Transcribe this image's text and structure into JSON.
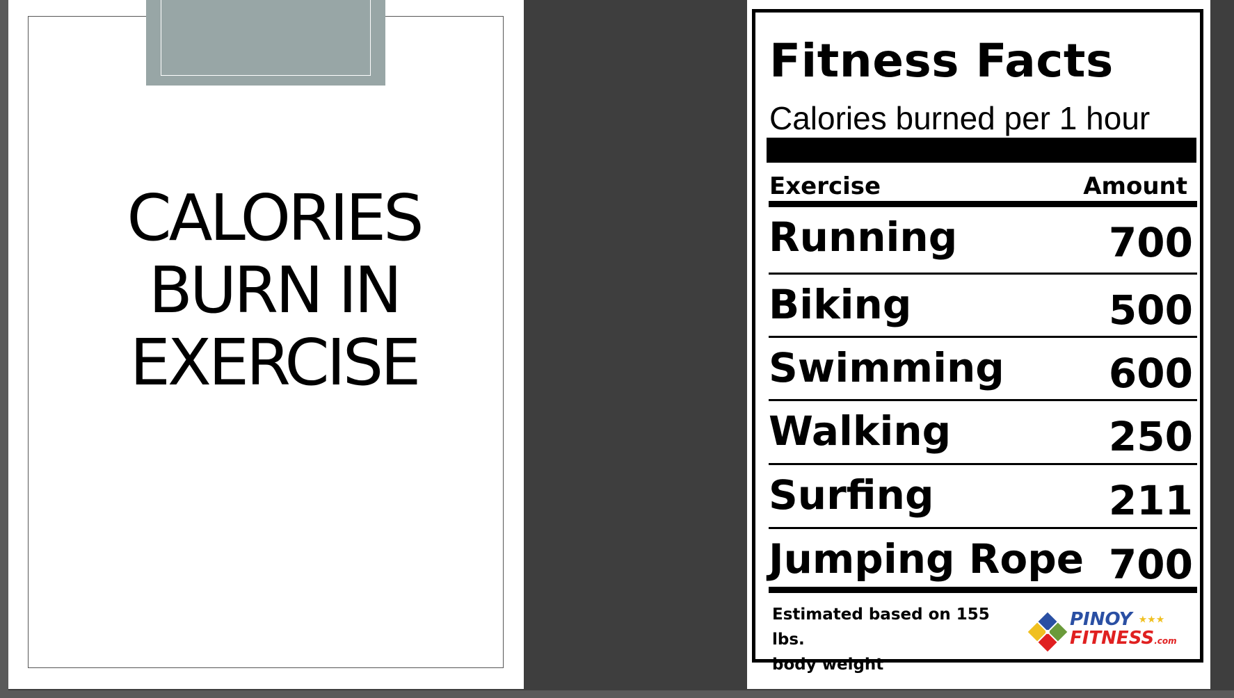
{
  "title_slide": {
    "title_lines": [
      "CALORIES",
      "BURN IN",
      "EXERCISE"
    ]
  },
  "fitness_card": {
    "title": "Fitness Facts",
    "subtitle": "Calories burned per 1 hour",
    "columns": {
      "exercise": "Exercise",
      "amount": "Amount"
    },
    "rows": [
      {
        "exercise": "Running",
        "amount": "700"
      },
      {
        "exercise": "Biking",
        "amount": "500"
      },
      {
        "exercise": "Swimming",
        "amount": "600"
      },
      {
        "exercise": "Walking",
        "amount": "250"
      },
      {
        "exercise": "Surfing",
        "amount": "211"
      },
      {
        "exercise": "Jumping Rope",
        "amount": "700"
      }
    ],
    "footnote_lines": [
      "Estimated based on 155 lbs.",
      "body weight"
    ],
    "logo": {
      "line1": "PINOY",
      "line2": "FITNESS",
      "suffix": ".com",
      "stars": "★★★"
    }
  },
  "colors": {
    "background": "#3e3e3e",
    "tab_block": "#98a6a6",
    "logo_blue": "#2a4fa3",
    "logo_red": "#e02020",
    "logo_yellow": "#f0c020",
    "logo_green": "#6a9a3a"
  }
}
